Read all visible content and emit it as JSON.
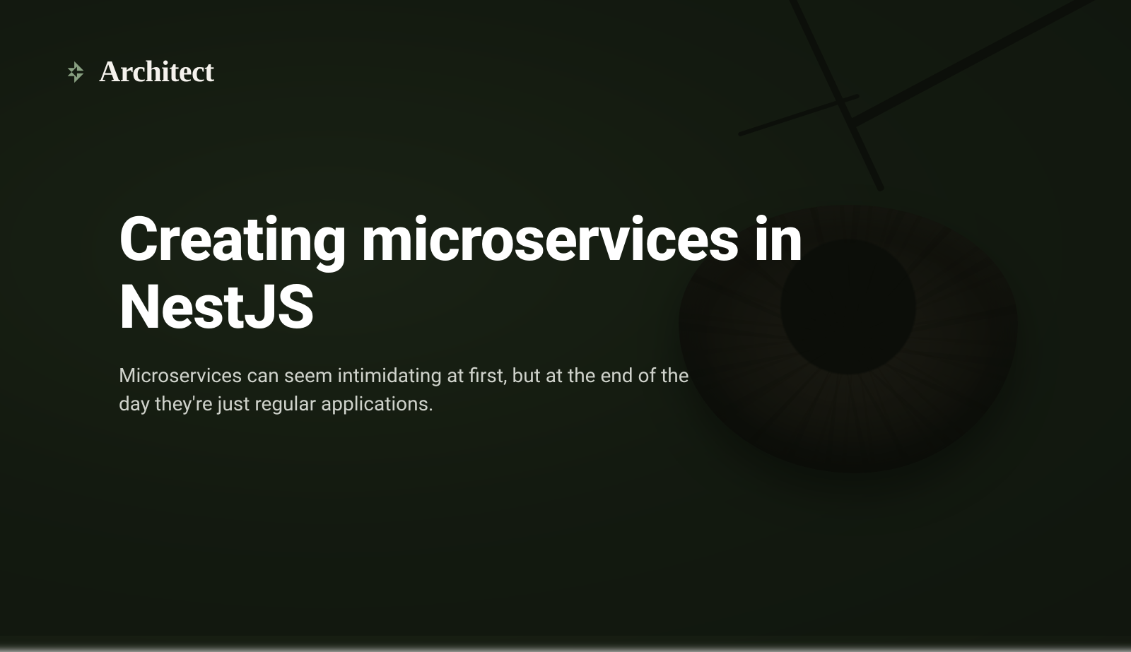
{
  "brand": {
    "name": "Architect",
    "accent_color": "#8fa888"
  },
  "hero": {
    "title": "Creating microservices in NestJS",
    "subtitle": "Microservices can seem intimidating at first, but at the end of the day they're just regular applications."
  }
}
